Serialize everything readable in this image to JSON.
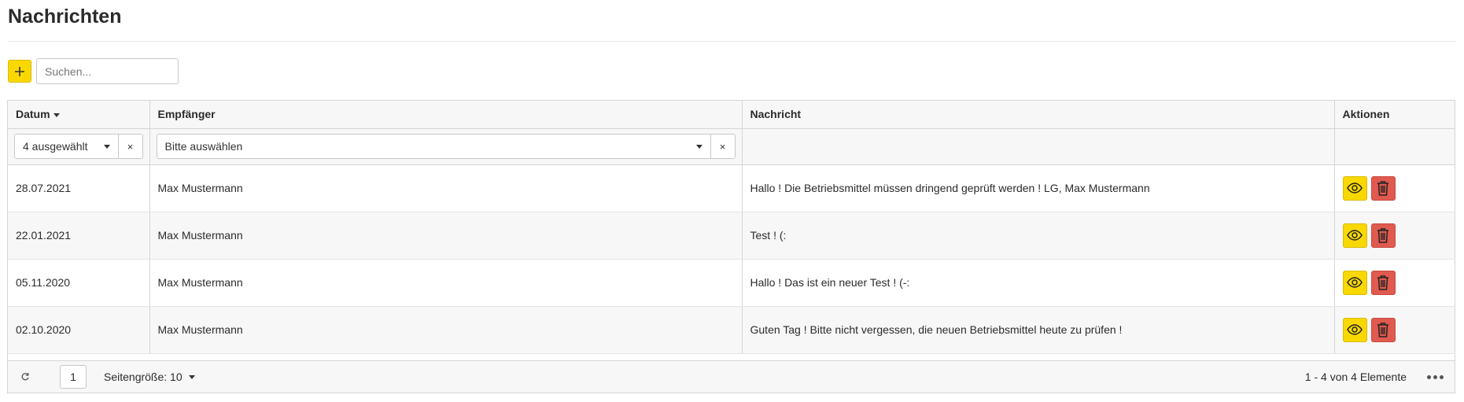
{
  "page": {
    "title": "Nachrichten"
  },
  "toolbar": {
    "add_icon": "plus-icon",
    "search_placeholder": "Suchen..."
  },
  "grid": {
    "columns": [
      {
        "label": "Datum",
        "sorted": "descending"
      },
      {
        "label": "Empfänger"
      },
      {
        "label": "Nachricht"
      },
      {
        "label": "Aktionen"
      }
    ],
    "filters": {
      "datum": {
        "value": "4 ausgewählt",
        "clear": "×"
      },
      "empfaenger": {
        "value": "Bitte auswählen",
        "clear": "×"
      }
    },
    "rows": [
      {
        "datum": "28.07.2021",
        "empfaenger": "Max Mustermann",
        "nachricht": "Hallo ! Die Betriebsmittel müssen dringend geprüft werden ! LG, Max Mustermann"
      },
      {
        "datum": "22.01.2021",
        "empfaenger": "Max Mustermann",
        "nachricht": "Test ! (:"
      },
      {
        "datum": "05.11.2020",
        "empfaenger": "Max Mustermann",
        "nachricht": "Hallo ! Das ist ein neuer Test ! (-:"
      },
      {
        "datum": "02.10.2020",
        "empfaenger": "Max Mustermann",
        "nachricht": "Guten Tag ! Bitte nicht vergessen, die neuen Betriebsmittel heute zu prüfen !"
      }
    ],
    "actions": {
      "view_icon": "eye-icon",
      "delete_icon": "trash-icon"
    }
  },
  "pager": {
    "current_page": "1",
    "page_size_label": "Seitengröße: 10",
    "count_text": "1 - 4 von 4 Elemente"
  },
  "colors": {
    "accent_yellow": "#f9d800",
    "danger_red": "#e05a4f",
    "header_bg": "#f7f7f7",
    "border": "#d5d5d5"
  }
}
